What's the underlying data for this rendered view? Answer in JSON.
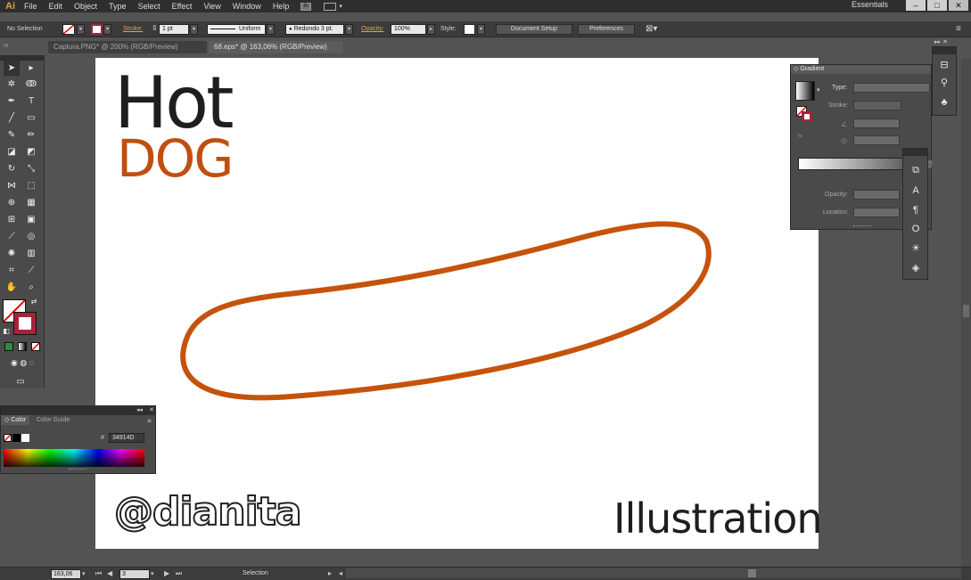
{
  "app": {
    "logo": "Ai",
    "menu": [
      "File",
      "Edit",
      "Object",
      "Type",
      "Select",
      "Effect",
      "View",
      "Window",
      "Help"
    ],
    "bridge_label": "Br",
    "workspace": "Essentials"
  },
  "window_controls": {
    "minimize": "–",
    "maximize": "□",
    "close": "✕"
  },
  "control_bar": {
    "selection": "No Selection",
    "stroke_label": "Stroke:",
    "stroke_weight": "1 pt",
    "profile": "Uniform",
    "brush": "Redondo 3 pt.",
    "opacity_label": "Opacity:",
    "opacity_value": "100%",
    "style_label": "Style:",
    "document_setup": "Document Setup",
    "preferences": "Preferences"
  },
  "tabs": [
    {
      "label": "Captura.PNG* @ 200% (RGB/Preview)",
      "active": false
    },
    {
      "label": "68.eps* @ 163,06% (RGB/Preview)",
      "active": true
    }
  ],
  "artboard": {
    "title_line1": "Hot",
    "title_line2": "DOG",
    "signature": "@dianita",
    "caption": "Illustration"
  },
  "color_panel": {
    "tab_color": "Color",
    "tab_guide": "Color Guide",
    "hex_label": "#",
    "hex_value": "34914D"
  },
  "gradient_panel": {
    "title": "Gradient",
    "type_label": "Type:",
    "stroke_label": "Stroke:",
    "opacity_label": "Opacity:",
    "location_label": "Location:"
  },
  "status_bar": {
    "zoom": "163,06",
    "page": "3",
    "tool": "Selection"
  },
  "colors": {
    "hot_text": "#1e1e1e",
    "dog_text": "#bf4f10",
    "sausage_stroke": "#c5530c",
    "stroke_swatch": "#a8213a"
  }
}
